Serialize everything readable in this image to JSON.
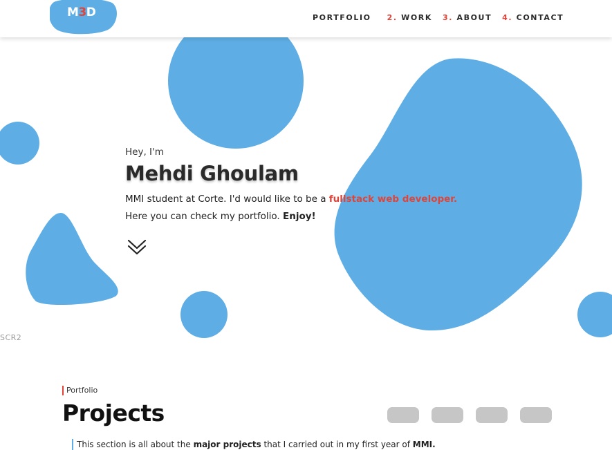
{
  "colors": {
    "accent": "#e0453a",
    "blob_blue": "#5eaee5",
    "filter_gray": "#c6c6c6"
  },
  "logo": {
    "text_start": "M",
    "text_mid": "3",
    "text_end": "D"
  },
  "nav": {
    "portfolio": {
      "label": "PORTFOLIO"
    },
    "work": {
      "num": "2.",
      "label": "WORK"
    },
    "about": {
      "num": "3.",
      "label": "ABOUT"
    },
    "contact": {
      "num": "4.",
      "label": "CONTACT"
    }
  },
  "hero": {
    "greeting": "Hey, I'm",
    "name": "Mehdi Ghoulam",
    "line1_prefix": "MMI student at Corte. I'd would like to be a ",
    "line1_highlight": "fullstack web developer.",
    "line2_prefix": "Here you can check my portfolio. ",
    "line2_strong": "Enjoy!",
    "scroll_icon": "double-chevron-down-icon"
  },
  "scr_label": "SCR2",
  "projects": {
    "tag": "Portfolio",
    "title": "Projects",
    "filter_count": 4,
    "desc_prefix": "This section is all about the ",
    "desc_strong1": "major projects",
    "desc_mid": " that I carried out in my first year of ",
    "desc_strong2": "MMI."
  }
}
